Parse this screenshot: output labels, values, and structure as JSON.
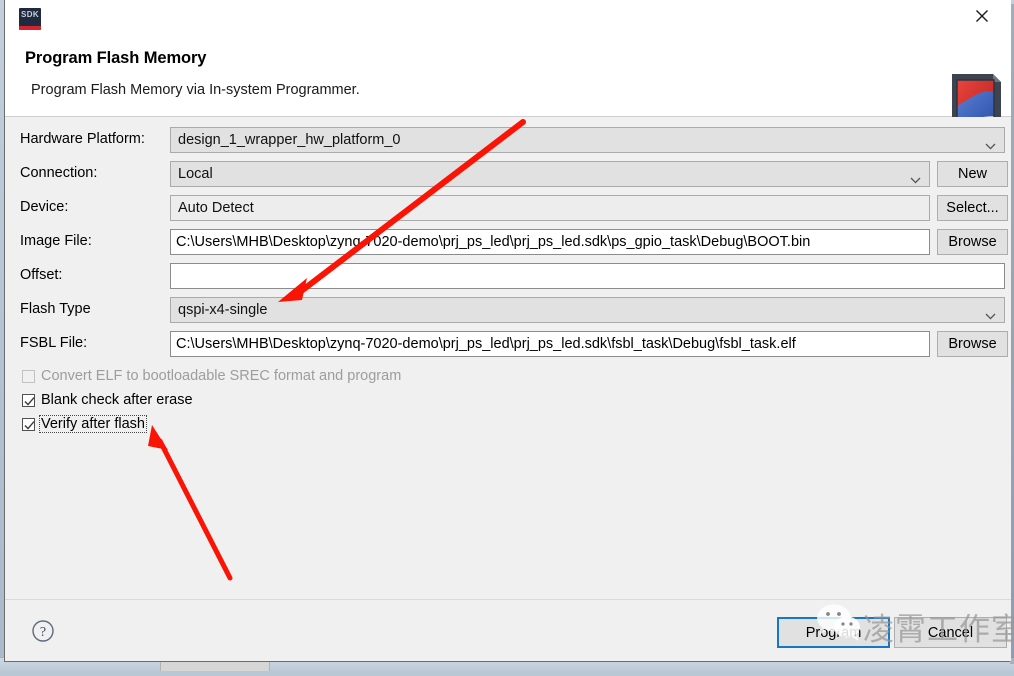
{
  "window": {
    "app_icon": "sdk-icon",
    "app_icon_text": "SDK",
    "close_label": "close-icon",
    "brand_logo": "xilinx-document-icon"
  },
  "heading": {
    "title": "Program Flash Memory",
    "subtitle": "Program Flash Memory via In-system Programmer."
  },
  "form": {
    "hardware_platform": {
      "label": "Hardware Platform:",
      "value": "design_1_wrapper_hw_platform_0",
      "control": "combo",
      "enabled": false
    },
    "connection": {
      "label": "Connection:",
      "value": "Local",
      "control": "combo",
      "button": "New"
    },
    "device": {
      "label": "Device:",
      "value": "Auto Detect",
      "control": "combo",
      "button": "Select..."
    },
    "image_file": {
      "label": "Image File:",
      "value": "C:\\Users\\MHB\\Desktop\\zynq-7020-demo\\prj_ps_led\\prj_ps_led.sdk\\ps_gpio_task\\Debug\\BOOT.bin",
      "placeholder": "",
      "control": "textbox",
      "button": "Browse"
    },
    "offset": {
      "label": "Offset:",
      "value": "",
      "placeholder": "",
      "control": "textbox"
    },
    "flash_type": {
      "label": "Flash Type",
      "value": "qspi-x4-single",
      "control": "combo"
    },
    "fsbl_file": {
      "label": "FSBL File:",
      "value": "C:\\Users\\MHB\\Desktop\\zynq-7020-demo\\prj_ps_led\\prj_ps_led.sdk\\fsbl_task\\Debug\\fsbl_task.elf",
      "placeholder": "",
      "control": "textbox",
      "button": "Browse"
    }
  },
  "checkboxes": [
    {
      "label": "Convert ELF to bootloadable SREC format and program",
      "checked": false,
      "enabled": false,
      "focused": false
    },
    {
      "label": "Blank check after erase",
      "checked": true,
      "enabled": true,
      "focused": false
    },
    {
      "label": "Verify after flash",
      "checked": true,
      "enabled": true,
      "focused": true
    }
  ],
  "footer": {
    "help_label": "help-icon",
    "program_label": "Program",
    "cancel_label": "Cancel"
  },
  "annotations": {
    "arrow_1_target": "qspi-x4-single",
    "arrow_2_target": "Verify after flash",
    "arrow_color": "#fa1405"
  },
  "watermark": {
    "text": "凌霄工作室",
    "icon": "wechat-icon"
  }
}
